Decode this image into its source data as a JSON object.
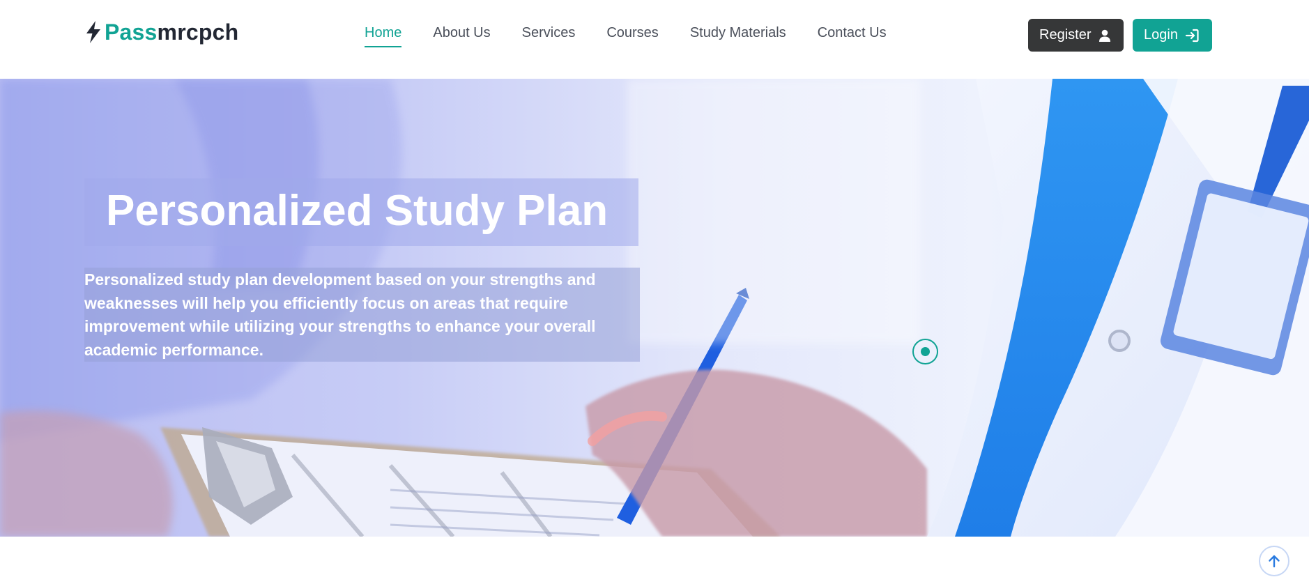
{
  "brand": {
    "part1": "Pass",
    "part2": "mrcpch",
    "accent_color": "#11a394",
    "dark_color": "#222733"
  },
  "nav": {
    "items": [
      {
        "label": "Home",
        "active": true
      },
      {
        "label": "About Us",
        "active": false
      },
      {
        "label": "Services",
        "active": false
      },
      {
        "label": "Courses",
        "active": false
      },
      {
        "label": "Study Materials",
        "active": false
      },
      {
        "label": "Contact Us",
        "active": false
      }
    ]
  },
  "auth": {
    "register_label": "Register",
    "register_icon": "user-icon",
    "login_label": "Login",
    "login_icon": "sign-in-icon"
  },
  "hero": {
    "title": "Personalized Study Plan",
    "description": "Personalized study plan development based on your strengths and weaknesses will help you efficiently focus on areas that require improvement while utilizing your strengths to enhance your overall academic performance.",
    "background_image": "doctor-writing-on-clipboard-photo"
  },
  "carousel": {
    "indicator_icon": "carousel-dot-icon"
  },
  "scroll_top": {
    "icon": "arrow-up-icon"
  }
}
